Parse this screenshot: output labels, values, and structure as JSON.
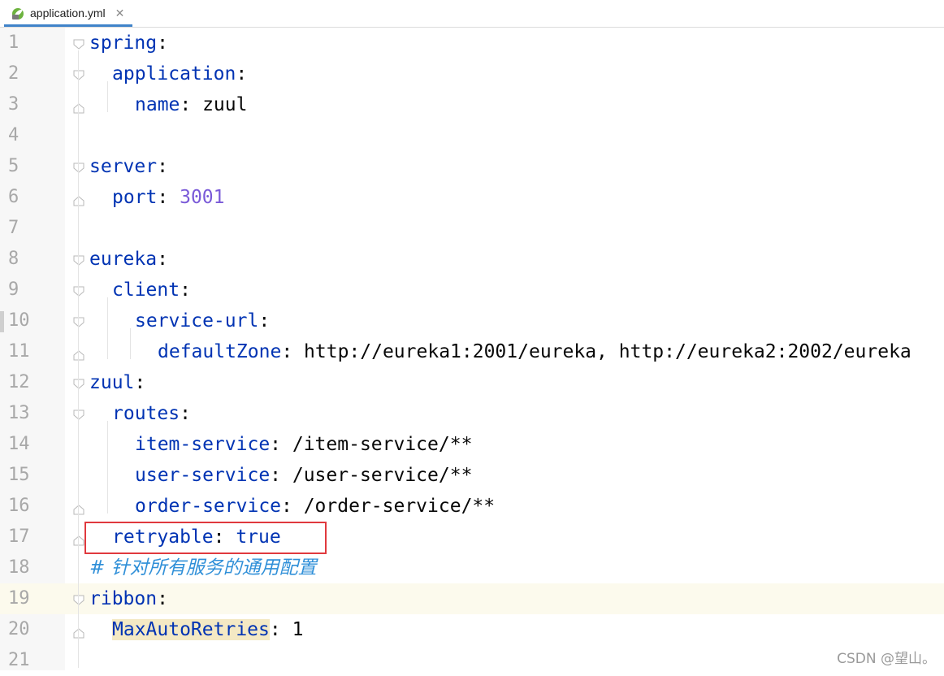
{
  "tab": {
    "filename": "application.yml",
    "close_glyph": "✕",
    "icon": "spring-leaf-icon"
  },
  "lines": [
    {
      "n": "1",
      "indent": 0,
      "parts": [
        {
          "t": "spring",
          "c": "k"
        },
        {
          "t": ":",
          "c": ""
        }
      ]
    },
    {
      "n": "2",
      "indent": 1,
      "parts": [
        {
          "t": "application",
          "c": "k"
        },
        {
          "t": ":",
          "c": ""
        }
      ]
    },
    {
      "n": "3",
      "indent": 2,
      "parts": [
        {
          "t": "name",
          "c": "k"
        },
        {
          "t": ": zuul",
          "c": ""
        }
      ]
    },
    {
      "n": "4",
      "indent": 0,
      "parts": []
    },
    {
      "n": "5",
      "indent": 0,
      "parts": [
        {
          "t": "server",
          "c": "k"
        },
        {
          "t": ":",
          "c": ""
        }
      ]
    },
    {
      "n": "6",
      "indent": 1,
      "parts": [
        {
          "t": "port",
          "c": "k"
        },
        {
          "t": ": ",
          "c": ""
        },
        {
          "t": "3001",
          "c": "n"
        }
      ]
    },
    {
      "n": "7",
      "indent": 0,
      "parts": []
    },
    {
      "n": "8",
      "indent": 0,
      "parts": [
        {
          "t": "eureka",
          "c": "k"
        },
        {
          "t": ":",
          "c": ""
        }
      ]
    },
    {
      "n": "9",
      "indent": 1,
      "parts": [
        {
          "t": "client",
          "c": "k"
        },
        {
          "t": ":",
          "c": ""
        }
      ]
    },
    {
      "n": "10",
      "indent": 2,
      "parts": [
        {
          "t": "service-url",
          "c": "k"
        },
        {
          "t": ":",
          "c": ""
        }
      ]
    },
    {
      "n": "11",
      "indent": 3,
      "parts": [
        {
          "t": "defaultZone",
          "c": "k"
        },
        {
          "t": ": http://eureka1:2001/eureka, http://eureka2:2002/eureka",
          "c": ""
        }
      ]
    },
    {
      "n": "12",
      "indent": 0,
      "parts": [
        {
          "t": "zuul",
          "c": "k"
        },
        {
          "t": ":",
          "c": ""
        }
      ]
    },
    {
      "n": "13",
      "indent": 1,
      "parts": [
        {
          "t": "routes",
          "c": "k"
        },
        {
          "t": ":",
          "c": ""
        }
      ]
    },
    {
      "n": "14",
      "indent": 2,
      "parts": [
        {
          "t": "item-service",
          "c": "k"
        },
        {
          "t": ": /item-service/**",
          "c": ""
        }
      ]
    },
    {
      "n": "15",
      "indent": 2,
      "parts": [
        {
          "t": "user-service",
          "c": "k"
        },
        {
          "t": ": /user-service/**",
          "c": ""
        }
      ]
    },
    {
      "n": "16",
      "indent": 2,
      "parts": [
        {
          "t": "order-service",
          "c": "k"
        },
        {
          "t": ": /order-service/**",
          "c": ""
        }
      ]
    },
    {
      "n": "17",
      "indent": 1,
      "parts": [
        {
          "t": "retryable",
          "c": "k"
        },
        {
          "t": ": ",
          "c": ""
        },
        {
          "t": "true",
          "c": "k"
        }
      ]
    },
    {
      "n": "18",
      "indent": 0,
      "parts": [
        {
          "t": "# ",
          "c": "c2"
        },
        {
          "t": "针对所有服务的通用配置",
          "c": "c2"
        }
      ]
    },
    {
      "n": "19",
      "indent": 0,
      "parts": [
        {
          "t": "ribbon",
          "c": "k"
        },
        {
          "t": ":",
          "c": ""
        }
      ]
    },
    {
      "n": "20",
      "indent": 1,
      "parts": [
        {
          "t": "MaxAutoRetries",
          "c": "k hl"
        },
        {
          "t": ": 1",
          "c": ""
        }
      ]
    },
    {
      "n": "21",
      "indent": 0,
      "parts": []
    }
  ],
  "current_line": "19",
  "highlighted_line": "17",
  "watermark": "CSDN @望山。",
  "colors": {
    "key": "#0033b3",
    "number": "#7a5ad8",
    "comment": "#2f8fd8",
    "current_line_bg": "#fcfaed",
    "highlight_box": "#e0393e"
  }
}
